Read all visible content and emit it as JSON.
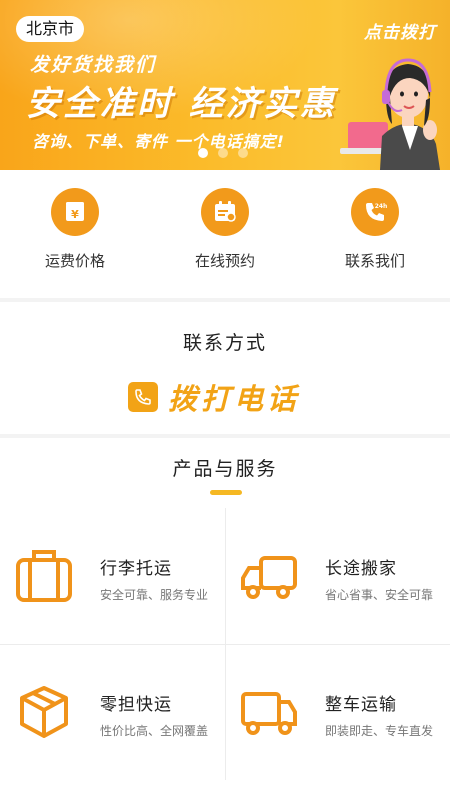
{
  "banner": {
    "city": "北京市",
    "dial_text": "点击拨打",
    "slogan_line1": "发好货找我们",
    "slogan_line2": "安全准时  经济实惠",
    "slogan_line3": "咨询、下单、寄件 一个电话搞定!",
    "slide_count": 3,
    "active_slide": 1
  },
  "quick_nav": [
    {
      "label": "运费价格",
      "icon": "yen-wallet-icon"
    },
    {
      "label": "在线预约",
      "icon": "calendar-icon"
    },
    {
      "label": "联系我们",
      "icon": "phone-24h-icon"
    }
  ],
  "contact": {
    "title": "联系方式",
    "call_label": "拨打电话"
  },
  "products": {
    "title": "产品与服务",
    "items": [
      {
        "name": "行李托运",
        "desc": "安全可靠、服务专业",
        "icon": "suitcase-icon"
      },
      {
        "name": "长途搬家",
        "desc": "省心省事、安全可靠",
        "icon": "truck-icon"
      },
      {
        "name": "零担快运",
        "desc": "性价比高、全网覆盖",
        "icon": "box-icon"
      },
      {
        "name": "整车运输",
        "desc": "即装即走、专车直发",
        "icon": "lorry-icon"
      }
    ]
  },
  "colors": {
    "accent": "#f29a1b",
    "banner": "#fbbb2a",
    "call": "#f2a316"
  }
}
